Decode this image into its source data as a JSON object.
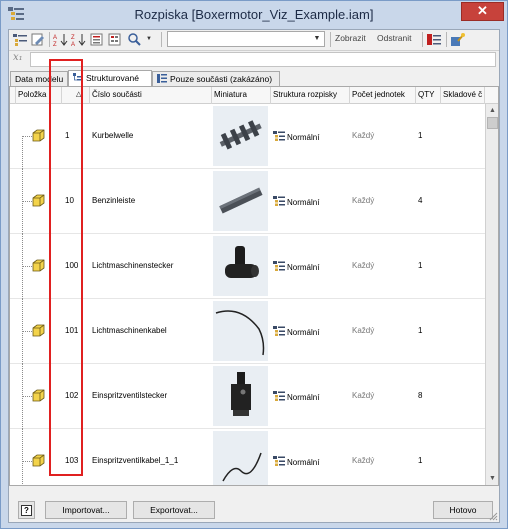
{
  "window": {
    "title": "Rozpiska [Boxermotor_Viz_Example.iam]",
    "close_glyph": "✕"
  },
  "toolbar": {
    "buttons": [
      "bom-icon",
      "edit-icon",
      "sort-az-icon",
      "sort-za-icon",
      "renumber-icon",
      "properties-icon",
      "search-icon"
    ],
    "filter_value": "",
    "show_label": "Zobrazit",
    "remove_label": "Odstranit"
  },
  "formula": {
    "fx": "x₁",
    "value": ""
  },
  "tabs": [
    {
      "label": "Data modelu",
      "active": false
    },
    {
      "label": "Strukturované",
      "active": true
    },
    {
      "label": "Pouze součásti (zakázáno)",
      "active": false
    }
  ],
  "columns": [
    "Položka",
    "Číslo součásti",
    "Miniatura",
    "Struktura rozpisky",
    "Počet jednotek",
    "QTY",
    "Skladové č"
  ],
  "sort_glyph": "△",
  "rows": [
    {
      "item": "1",
      "part": "Kurbelwelle",
      "struct": "Normální",
      "unit": "Každý",
      "qty": "1"
    },
    {
      "item": "10",
      "part": "Benzinleiste",
      "struct": "Normální",
      "unit": "Každý",
      "qty": "4"
    },
    {
      "item": "100",
      "part": "Lichtmaschinenstecker",
      "struct": "Normální",
      "unit": "Každý",
      "qty": "1"
    },
    {
      "item": "101",
      "part": "Lichtmaschinenkabel",
      "struct": "Normální",
      "unit": "Každý",
      "qty": "1"
    },
    {
      "item": "102",
      "part": "Einspritzventilstecker",
      "struct": "Normální",
      "unit": "Každý",
      "qty": "8"
    },
    {
      "item": "103",
      "part": "Einspritzventilkabel_1_1",
      "struct": "Normální",
      "unit": "Každý",
      "qty": "1"
    }
  ],
  "buttons": {
    "help": "?",
    "import": "Importovat...",
    "export": "Exportovat...",
    "done": "Hotovo"
  },
  "colors": {
    "highlight": "#e02020",
    "close": "#c7423b"
  }
}
